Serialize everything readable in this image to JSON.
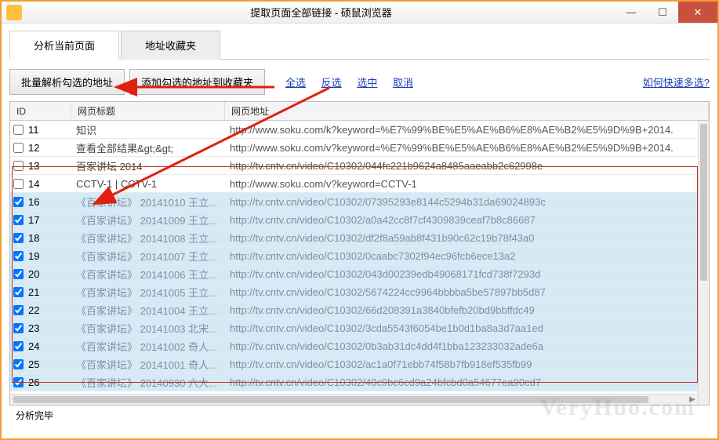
{
  "window": {
    "title": "提取页面全部链接 - 硕鼠浏览器"
  },
  "tabs": {
    "t1": "分析当前页面",
    "t2": "地址收藏夹"
  },
  "toolbar": {
    "btn1": "批量解析勾选的地址",
    "btn2": "添加勾选的地址到收藏夹",
    "links": {
      "all": "全选",
      "inv": "反选",
      "sel": "选中",
      "cancel": "取消"
    },
    "help": "如何快速多选?"
  },
  "grid": {
    "headers": {
      "id": "ID",
      "title": "网页标题",
      "url": "网页地址"
    }
  },
  "rows": [
    {
      "id": "11",
      "chk": false,
      "sel": false,
      "title": "知识",
      "url": "http://www.soku.com/k?keyword=%E7%99%BE%E5%AE%B6%E8%AE%B2%E5%9D%9B+2014."
    },
    {
      "id": "12",
      "chk": false,
      "sel": false,
      "title": "查看全部结果&gt;&gt;",
      "url": "http://www.soku.com/v?keyword=%E7%99%BE%E5%AE%B6%E8%AE%B2%E5%9D%9B+2014."
    },
    {
      "id": "13",
      "chk": false,
      "sel": false,
      "title": "百家讲坛 2014",
      "url": "http://tv.cntv.cn/video/C10302/044fc221b9624a8485aaeabb2c62998e"
    },
    {
      "id": "14",
      "chk": false,
      "sel": false,
      "title": "CCTV-1 | CCTV-1",
      "url": "http://www.soku.com/v?keyword=CCTV-1"
    },
    {
      "id": "16",
      "chk": true,
      "sel": true,
      "title": "《百家讲坛》 20141010 王立...",
      "url": "http://tv.cntv.cn/video/C10302/07395293e8144c5294b31da69024893c"
    },
    {
      "id": "17",
      "chk": true,
      "sel": true,
      "title": "《百家讲坛》 20141009 王立...",
      "url": "http://tv.cntv.cn/video/C10302/a0a42cc8f7cf4309839ceaf7b8c86687"
    },
    {
      "id": "18",
      "chk": true,
      "sel": true,
      "title": "《百家讲坛》 20141008 王立...",
      "url": "http://tv.cntv.cn/video/C10302/df2f8a59ab8f431b90c62c19b78f43a0"
    },
    {
      "id": "19",
      "chk": true,
      "sel": true,
      "title": "《百家讲坛》 20141007 王立...",
      "url": "http://tv.cntv.cn/video/C10302/0caabc7302f94ec96fcb6ece13a2"
    },
    {
      "id": "20",
      "chk": true,
      "sel": true,
      "title": "《百家讲坛》 20141006 王立...",
      "url": "http://tv.cntv.cn/video/C10302/043d00239edb49068171fcd738f7293d"
    },
    {
      "id": "21",
      "chk": true,
      "sel": true,
      "title": "《百家讲坛》 20141005 王立...",
      "url": "http://tv.cntv.cn/video/C10302/5674224cc9964bbbba5be57897bb5d87"
    },
    {
      "id": "22",
      "chk": true,
      "sel": true,
      "title": "《百家讲坛》 20141004 王立...",
      "url": "http://tv.cntv.cn/video/C10302/66d208391a3840bfefb20bd9bbffdc49"
    },
    {
      "id": "23",
      "chk": true,
      "sel": true,
      "title": "《百家讲坛》 20141003 北宋...",
      "url": "http://tv.cntv.cn/video/C10302/3cda5543f6054be1b0d1ba8a3d7aa1ed"
    },
    {
      "id": "24",
      "chk": true,
      "sel": true,
      "title": "《百家讲坛》 20141002 奇人...",
      "url": "http://tv.cntv.cn/video/C10302/0b3ab31dc4dd4f1bba123233032ade6a"
    },
    {
      "id": "25",
      "chk": true,
      "sel": true,
      "title": "《百家讲坛》 20141001 奇人...",
      "url": "http://tv.cntv.cn/video/C10302/ac1a0f71ebb74f58b7fb918ef535fb99"
    },
    {
      "id": "26",
      "chk": true,
      "sel": true,
      "title": "《百家讲坛》 20140930 六大...",
      "url": "http://tv.cntv.cn/video/C10302/40c9bc6cd9a24bfcbd0a54677ea90cd7"
    }
  ],
  "status": "分析完毕",
  "watermark": "VeryHuo.com"
}
